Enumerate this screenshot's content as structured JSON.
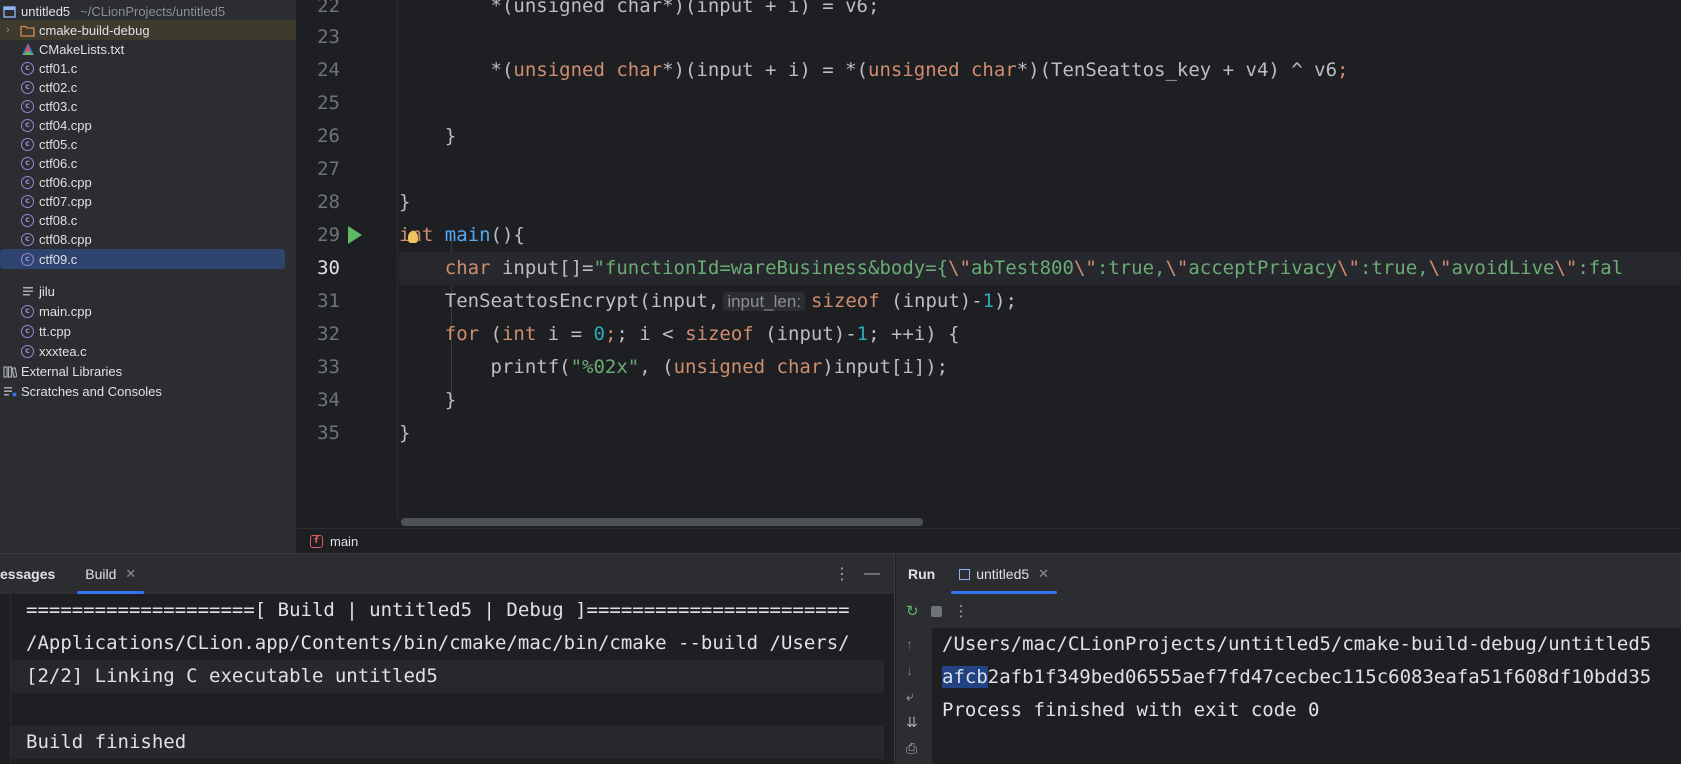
{
  "project": {
    "name": "untitled5",
    "path": "~/CLionProjects/untitled5",
    "items": [
      {
        "label": "cmake-build-debug",
        "type": "folder"
      },
      {
        "label": "CMakeLists.txt",
        "type": "cmake"
      },
      {
        "label": "ctf01.c",
        "type": "c"
      },
      {
        "label": "ctf02.c",
        "type": "c"
      },
      {
        "label": "ctf03.c",
        "type": "c"
      },
      {
        "label": "ctf04.cpp",
        "type": "cpp"
      },
      {
        "label": "ctf05.c",
        "type": "c"
      },
      {
        "label": "ctf06.c",
        "type": "c"
      },
      {
        "label": "ctf06.cpp",
        "type": "cpp"
      },
      {
        "label": "ctf07.cpp",
        "type": "cpp"
      },
      {
        "label": "ctf08.c",
        "type": "c"
      },
      {
        "label": "ctf08.cpp",
        "type": "cpp"
      },
      {
        "label": "ctf09.c",
        "type": "c"
      },
      {
        "label": "jilu",
        "type": "text"
      },
      {
        "label": "main.cpp",
        "type": "cpp"
      },
      {
        "label": "tt.cpp",
        "type": "cpp"
      },
      {
        "label": "xxxtea.c",
        "type": "c"
      }
    ],
    "external_libraries": "External Libraries",
    "scratches": "Scratches and Consoles"
  },
  "editor": {
    "current_line": "30",
    "line_numbers": [
      "22",
      "23",
      "24",
      "25",
      "26",
      "27",
      "28",
      "29",
      "30",
      "31",
      "32",
      "33",
      "34",
      "35"
    ],
    "code": {
      "l22": "        *(unsigned char*)(input + i) = v6;",
      "l24_a": "        *(",
      "l24_k1": "unsigned char",
      "l24_b": "*)(input + i) = *(",
      "l24_k2": "unsigned char",
      "l24_c": "*)(TenSeattos_key + v4) ^ v6",
      "l24_d": ";",
      "l26": "    }",
      "l28": "}",
      "l29_k": "int",
      "l29_fn": "main",
      "l29_rest": "(){",
      "l30_k": "char",
      "l30_a": " input[]=",
      "l30_s1": "\"functionId=wareBusiness&body={",
      "l30_e1": "\\\"",
      "l30_s2": "abTest800",
      "l30_e2": "\\\"",
      "l30_s3": ":true,",
      "l30_e3": "\\\"",
      "l30_s4": "acceptPrivacy",
      "l30_e4": "\\\"",
      "l30_s5": ":true,",
      "l30_e5": "\\\"",
      "l30_s6": "avoidLive",
      "l30_e6": "\\\"",
      "l30_s7": ":fal",
      "l31_a": "TenSeattosEncrypt(input,",
      "l31_hint": "input_len:",
      "l31_k": "sizeof",
      "l31_b": " (input)-",
      "l31_n": "1",
      "l31_c": ");",
      "l32_k1": "for",
      "l32_a": " (",
      "l32_k2": "int",
      "l32_b": " i = ",
      "l32_n1": "0",
      "l32_c": "; i < ",
      "l32_k3": "sizeof",
      "l32_d": " (input)-",
      "l32_n2": "1",
      "l32_e": "; ++i) {",
      "l33_a": "printf(",
      "l33_s": "\"%02x\"",
      "l33_b": ", (",
      "l33_k": "unsigned char",
      "l33_c": ")input[i]);",
      "l34": "    }",
      "l35": "}"
    },
    "breadcrumb_function": "main"
  },
  "build_panel": {
    "tab_messages": "essages",
    "tab_build": "Build",
    "lines": [
      "====================[ Build | untitled5 | Debug ]=======================",
      "/Applications/CLion.app/Contents/bin/cmake/mac/bin/cmake --build /Users/",
      "[2/2] Linking C executable untitled5",
      "",
      "Build finished"
    ]
  },
  "run_panel": {
    "tab_run": "Run",
    "tab_config": "untitled5",
    "line1": "/Users/mac/CLionProjects/untitled5/cmake-build-debug/untitled5",
    "line2_selected": "afcb",
    "line2_rest": "2afb1f349bed06555aef7fd47cecbec115c6083eafa51f608df10bdd35",
    "line3": "Process finished with exit code 0"
  },
  "colors": {
    "keyword": "#cf8e6d",
    "string": "#6aab73",
    "number": "#2aacb8",
    "accent": "#3574f0",
    "selection": "#2e436e"
  }
}
